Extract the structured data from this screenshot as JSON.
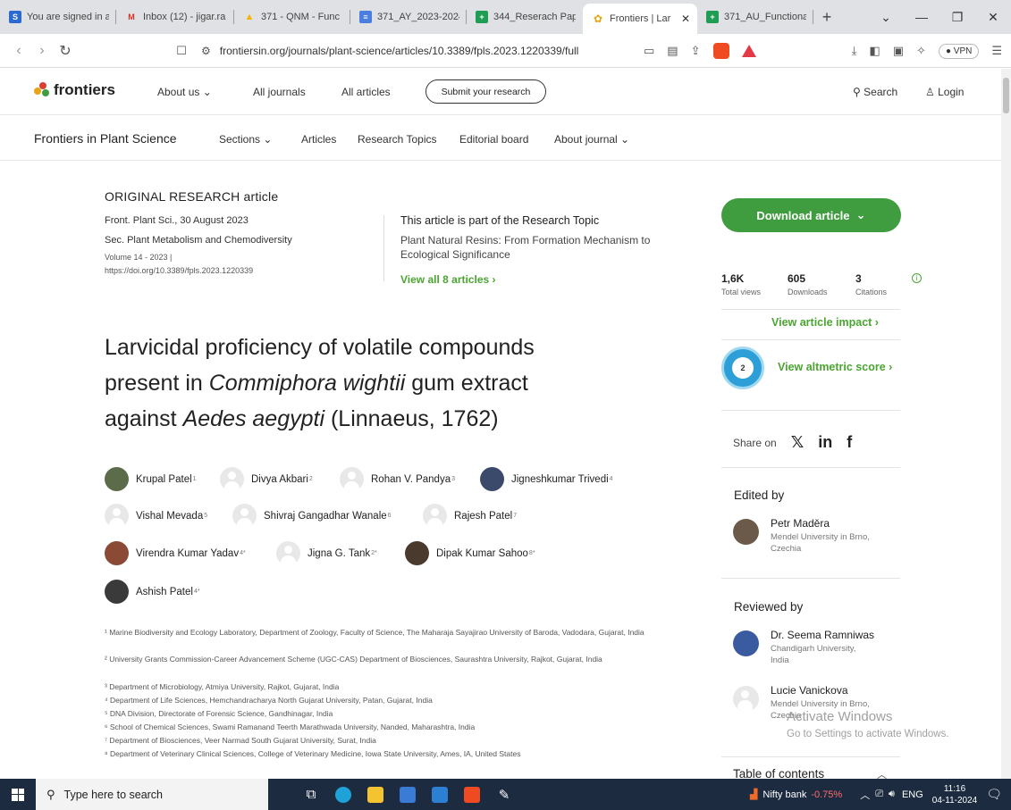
{
  "browser": {
    "tabs": [
      {
        "label": "You are signed in a",
        "icon": "s-app-icon",
        "color": "#2a6ad1",
        "letter": "S"
      },
      {
        "label": "Inbox (12) - jigar.ra",
        "icon": "gmail-icon",
        "color": "#ffffff",
        "letter": "M"
      },
      {
        "label": "371 - QNM - Func",
        "icon": "drive-icon",
        "color": "#ffffff",
        "letter": "▲"
      },
      {
        "label": "371_AY_2023-2024",
        "icon": "docs-icon",
        "color": "#4a7fe0",
        "letter": "≡"
      },
      {
        "label": "344_Reserach Pape",
        "icon": "sheets-icon",
        "color": "#1f9d55",
        "letter": "+"
      },
      {
        "label": "Frontiers | Lar",
        "icon": "frontiers-icon",
        "color": "#ffffff",
        "letter": "✿",
        "active": true
      },
      {
        "label": "371_AU_Functiona",
        "icon": "sheets-icon",
        "color": "#1f9d55",
        "letter": "+"
      }
    ],
    "url": "frontiersin.org/journals/plant-science/articles/10.3389/fpls.2023.1220339/full",
    "vpn_label": "VPN"
  },
  "site": {
    "logo": "frontiers",
    "nav": [
      "About us",
      "All journals",
      "All articles"
    ],
    "submit": "Submit your research",
    "search": "Search",
    "login": "Login",
    "journal": "Frontiers in Plant Science",
    "subnav": [
      "Sections",
      "Articles",
      "Research Topics",
      "Editorial board",
      "About journal"
    ]
  },
  "article": {
    "type": "ORIGINAL RESEARCH article",
    "citation": "Front. Plant Sci., 30 August 2023",
    "section": "Sec. Plant Metabolism and Chemodiversity",
    "volume": "Volume 14 - 2023 |",
    "doi": "https://doi.org/10.3389/fpls.2023.1220339",
    "research_topic_intro": "This article is part of the Research Topic",
    "research_topic": "Plant Natural Resins: From Formation Mechanism to Ecological Significance",
    "view_all": "View all 8 articles",
    "title_line1": "Larvicidal proficiency of volatile compounds",
    "title_line2_a": "present in ",
    "title_line2_b": "Commiphora wightii",
    "title_line2_c": " gum extract",
    "title_line3_a": "against ",
    "title_line3_b": "Aedes aegypti",
    "title_line3_c": " (Linnaeus, 1762)",
    "authors": [
      {
        "name": "Krupal Patel",
        "sup": "1"
      },
      {
        "name": "Divya Akbari",
        "sup": "2"
      },
      {
        "name": "Rohan V. Pandya",
        "sup": "3"
      },
      {
        "name": "Jigneshkumar Trivedi",
        "sup": "4"
      },
      {
        "name": "Vishal Mevada",
        "sup": "5"
      },
      {
        "name": "Shivraj Gangadhar Wanale",
        "sup": "6"
      },
      {
        "name": "Rajesh Patel",
        "sup": "7"
      },
      {
        "name": "Virendra Kumar Yadav",
        "sup": "4*"
      },
      {
        "name": "Jigna G. Tank",
        "sup": "2*"
      },
      {
        "name": "Dipak Kumar Sahoo",
        "sup": "8*"
      },
      {
        "name": "Ashish Patel",
        "sup": "4*"
      }
    ],
    "affiliations": [
      "¹ Marine Biodiversity and Ecology Laboratory, Department of Zoology, Faculty of Science, The Maharaja Sayajirao University of Baroda, Vadodara, Gujarat, India",
      "² University Grants Commission-Career Advancement Scheme (UGC-CAS) Department of Biosciences, Saurashtra University, Rajkot, Gujarat, India",
      "³ Department of Microbiology, Atmiya University, Rajkot, Gujarat, India",
      "⁴ Department of Life Sciences, Hemchandracharya North Gujarat University, Patan, Gujarat, India",
      "⁵ DNA Division, Directorate of Forensic Science, Gandhinagar, India",
      "⁶ School of Chemical Sciences, Swami Ramanand Teerth Marathwada University, Nanded, Maharashtra, India",
      "⁷ Department of Biosciences, Veer Narmad South Gujarat University, Surat, India",
      "⁸ Department of Veterinary Clinical Sciences, College of Veterinary Medicine, Iowa State University, Ames, IA, United States"
    ]
  },
  "sidebar": {
    "download": "Download article",
    "metrics": [
      {
        "num": "1,6K",
        "label": "Total views"
      },
      {
        "num": "605",
        "label": "Downloads"
      },
      {
        "num": "3",
        "label": "Citations"
      }
    ],
    "impact": "View article impact",
    "altmetric_score": "2",
    "altmetric": "View altmetric score",
    "share": "Share on",
    "edited_by": "Edited by",
    "editor": {
      "name": "Petr Maděra",
      "inst1": "Mendel University in Brno,",
      "inst2": "Czechia"
    },
    "reviewed_by": "Reviewed by",
    "reviewers": [
      {
        "name": "Dr. Seema Ramniwas",
        "inst1": "Chandigarh University,",
        "inst2": "India"
      },
      {
        "name": "Lucie Vanickova",
        "inst1": "Mendel University in Brno,",
        "inst2": "Czechia"
      }
    ],
    "toc": "Table of contents"
  },
  "watermark": {
    "line1": "Activate Windows",
    "line2": "Go to Settings to activate Windows."
  },
  "taskbar": {
    "search_placeholder": "Type here to search",
    "market": "Nifty bank",
    "market_change": "-0.75%",
    "lang": "ENG",
    "time": "11:16",
    "date": "04-11-2024"
  }
}
